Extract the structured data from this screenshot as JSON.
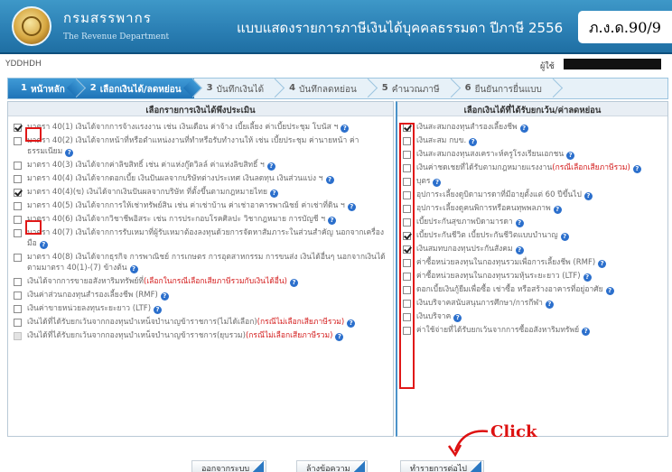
{
  "header": {
    "brand_th": "กรมสรรพากร",
    "brand_en": "The Revenue Department",
    "title": "แบบแสดงรายการภาษีเงินได้บุคคลธรรมดา ปีภาษี 2556",
    "form_code": "ภ.ง.ด.90/9"
  },
  "subbar": {
    "id_left": "YDDHDH",
    "user_label": "ผู้ใช้"
  },
  "steps": [
    {
      "num": "1",
      "label": "หน้าหลัก"
    },
    {
      "num": "2",
      "label": "เลือกเงินได้/ลดหย่อน"
    },
    {
      "num": "3",
      "label": "บันทึกเงินได้"
    },
    {
      "num": "4",
      "label": "บันทึกลดหย่อน"
    },
    {
      "num": "5",
      "label": "คำนวณภาษี"
    },
    {
      "num": "6",
      "label": "ยืนยันการยื่นแบบ"
    }
  ],
  "left_panel": {
    "title": "เลือกรายการเงินได้พึงประเมิน",
    "items": [
      {
        "checked": true,
        "text": "มาตรา 40(1) เงินได้จากการจ้างแรงงาน เช่น เงินเดือน ค่าจ้าง เบี้ยเลี้ยง ค่าเบี้ยประชุม โบนัส ฯ",
        "red": ""
      },
      {
        "checked": false,
        "text": "มาตรา 40(2) เงินได้จากหน้าที่หรือตำแหน่งงานที่ทำหรือรับทำงานให้ เช่น เบี้ยประชุม ค่านายหน้า ค่าธรรมเนียม",
        "red": ""
      },
      {
        "checked": false,
        "text": "มาตรา 40(3) เงินได้จากค่าลิขสิทธิ์ เช่น ค่าแห่งกู๊ดวิลล์ ค่าแห่งลิขสิทธิ์ ฯ",
        "red": ""
      },
      {
        "checked": false,
        "text": "มาตรา 40(4) เงินได้จากดอกเบี้ย เงินปันผลจากบริษัทต่างประเทศ เงินลดทุน เงินส่วนแบ่ง ฯ",
        "red": ""
      },
      {
        "checked": true,
        "text": "มาตรา 40(4)(ข) เงินได้จากเงินปันผลจากบริษัท ที่ตั้งขึ้นตามกฎหมายไทย",
        "red": ""
      },
      {
        "checked": false,
        "text": "มาตรา 40(5) เงินได้จากการให้เช่าทรัพย์สิน เช่น ค่าเช่าบ้าน ค่าเช่าอาคารพาณิชย์ ค่าเช่าที่ดิน ฯ",
        "red": ""
      },
      {
        "checked": false,
        "text": "มาตรา 40(6) เงินได้จากวิชาชีพอิสระ เช่น การประกอบโรคศิลปะ วิชากฎหมาย การบัญชี ฯ",
        "red": ""
      },
      {
        "checked": false,
        "text": "มาตรา 40(7) เงินได้จากการรับเหมาที่ผู้รับเหมาต้องลงทุนด้วยการจัดหาสัมภาระในส่วนสำคัญ นอกจากเครื่องมือ",
        "red": ""
      },
      {
        "checked": false,
        "text": "มาตรา 40(8) เงินได้จากธุรกิจ การพาณิชย์ การเกษตร การอุตสาหกรรม การขนส่ง เงินได้อื่นๆ นอกจากเงินได้ตามมาตรา 40(1)-(7) ข้างต้น",
        "red": ""
      },
      {
        "checked": false,
        "text": "เงินได้จากการขายอสังหาริมทรัพย์ที่",
        "red": "(เลือกในกรณีเลือกเสียภาษีรวมกับเงินได้อื่น)"
      },
      {
        "checked": false,
        "text": "เงินค่าส่วนกองทุนสำรองเลี้ยงชีพ (RMF)",
        "red": ""
      },
      {
        "checked": false,
        "text": "เงินค่าขายหน่วยลงทุนระยะยาว (LTF)",
        "red": ""
      },
      {
        "checked": false,
        "text": "เงินได้ที่ได้รับยกเว้นจากกองทุนบำเหน็จบำนาญข้าราชการ(ไม่ได้เลือก)",
        "red": "(กรณีไม่เลือกเสียภาษีรวม)"
      },
      {
        "checked": false,
        "disabled": true,
        "text": "เงินได้ที่ได้รับยกเว้นจากกองทุนบำเหน็จบำนาญข้าราชการ(ยุบรวม)",
        "red": "(กรณีไม่เลือกเสียภาษีรวม)"
      }
    ]
  },
  "right_panel": {
    "title": "เลือกเงินได้ที่ได้รับยกเว้น/ค่าลดหย่อน",
    "items": [
      {
        "checked": true,
        "text": "เงินสะสมกองทุนสำรองเลี้ยงชีพ",
        "red": ""
      },
      {
        "checked": false,
        "text": "เงินสะสม กบข.",
        "red": ""
      },
      {
        "checked": false,
        "text": "เงินสะสมกองทุนสงเคราะห์ครูโรงเรียนเอกชน",
        "red": ""
      },
      {
        "checked": false,
        "text": "เงินค่าชดเชยที่ได้รับตามกฎหมายแรงงาน",
        "red": "(กรณีเลือกเสียภาษีรวม)"
      },
      {
        "checked": false,
        "text": "บุตร",
        "red": ""
      },
      {
        "checked": false,
        "text": "อุปการะเลี้ยงดูบิดามารดาที่มีอายุตั้งแต่ 60 ปีขึ้นไป",
        "red": ""
      },
      {
        "checked": false,
        "text": "อุปการะเลี้ยงดูคนพิการหรือคนทุพพลภาพ",
        "red": ""
      },
      {
        "checked": false,
        "text": "เบี้ยประกันสุขภาพบิดามารดา",
        "red": ""
      },
      {
        "checked": true,
        "text": "เบี้ยประกันชีวิต เบี้ยประกันชีวิตแบบบำนาญ",
        "red": ""
      },
      {
        "checked": true,
        "text": "เงินสมทบกองทุนประกันสังคม",
        "red": ""
      },
      {
        "checked": false,
        "text": "ค่าซื้อหน่วยลงทุนในกองทุนรวมเพื่อการเลี้ยงชีพ (RMF)",
        "red": ""
      },
      {
        "checked": false,
        "text": "ค่าซื้อหน่วยลงทุนในกองทุนรวมหุ้นระยะยาว (LTF)",
        "red": ""
      },
      {
        "checked": false,
        "text": "ดอกเบี้ยเงินกู้ยืมเพื่อซื้อ เช่าซื้อ หรือสร้างอาคารที่อยู่อาศัย",
        "red": ""
      },
      {
        "checked": false,
        "text": "เงินบริจาคสนับสนุนการศึกษา/การกีฬา",
        "red": ""
      },
      {
        "checked": false,
        "text": "เงินบริจาค",
        "red": ""
      },
      {
        "checked": false,
        "text": "ค่าใช้จ่ายที่ได้รับยกเว้นจากการซื้ออสังหาริมทรัพย์",
        "red": ""
      }
    ]
  },
  "buttons": {
    "logout": "ออกจากระบบ",
    "clear": "ล้างข้อความ",
    "next": "ทำรายการต่อไป"
  },
  "annotation": {
    "click": "Click"
  },
  "colors": {
    "header_blue": "#2a7eb3",
    "highlight_red": "#e01818",
    "info_blue": "#2b6fcc"
  }
}
